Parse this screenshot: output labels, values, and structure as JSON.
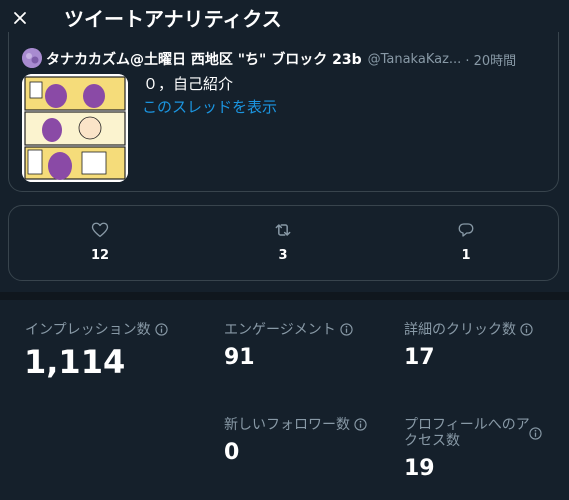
{
  "header": {
    "title": "ツイートアナリティクス",
    "close_icon": "close-icon"
  },
  "tweet": {
    "author_name": "タナカカズム@土曜日 西地区 \"ち\" ブロック 23b",
    "author_handle": "@TanakaKaz...",
    "time": "· 20時間",
    "text": "０，自己紹介",
    "thread_link": "このスレッドを表示",
    "accent_color": "#1b95e0"
  },
  "engagement": {
    "likes": {
      "icon": "heart-icon",
      "count": "12"
    },
    "retweets": {
      "icon": "retweet-icon",
      "count": "3"
    },
    "replies": {
      "icon": "reply-icon",
      "count": "1"
    }
  },
  "metrics": {
    "impressions": {
      "label": "インプレッション数",
      "value": "1,114"
    },
    "engagements": {
      "label": "エンゲージメント",
      "value": "91"
    },
    "detail_clicks": {
      "label": "詳細のクリック数",
      "value": "17"
    },
    "new_followers": {
      "label": "新しいフォロワー数",
      "value": "0"
    },
    "profile_visits": {
      "label_line1": "プロフィールへのア",
      "label_line2": "クセス数",
      "value": "19"
    }
  },
  "colors": {
    "background": "#15202b",
    "border": "#38444d",
    "secondary_text": "#8899a6"
  }
}
